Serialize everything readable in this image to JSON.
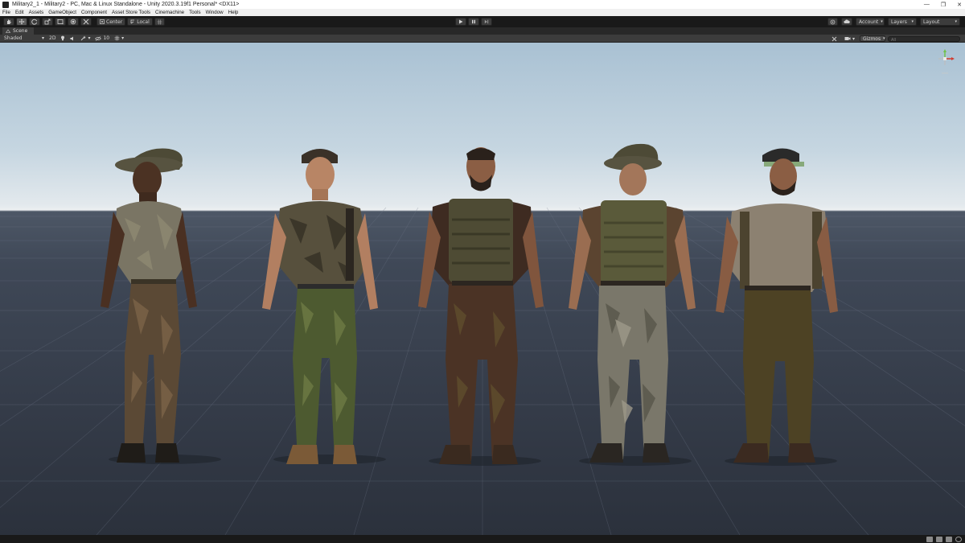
{
  "window": {
    "title": "Military2_1 - Military2 - PC, Mac & Linux Standalone - Unity 2020.3.19f1 Personal* <DX11>",
    "controls": [
      "—",
      "❐",
      "✕"
    ]
  },
  "menu": [
    "File",
    "Edit",
    "Assets",
    "GameObject",
    "Component",
    "Asset Store Tools",
    "Cinemachine",
    "Tools",
    "Window",
    "Help"
  ],
  "toolbar": {
    "pivot_label": "Center",
    "space_label": "Local",
    "account_label": "Account",
    "layers_label": "Layers",
    "layout_label": "Layout"
  },
  "scene_tab": {
    "label": "Scene"
  },
  "scene_toolbar": {
    "shading_mode": "Shaded",
    "mode_2d": "2D",
    "fx_count": "10",
    "gizmos_label": "Gizmos",
    "search_placeholder": "All"
  },
  "colors": {
    "editor_bg": "#191919",
    "panel": "#3c3c3c",
    "sky_top": "#a9c1d3",
    "ground": "#3f4857",
    "gizmo_x": "#d23b2e",
    "gizmo_y": "#6fc24a",
    "gizmo_z": "#3a6fd1"
  }
}
